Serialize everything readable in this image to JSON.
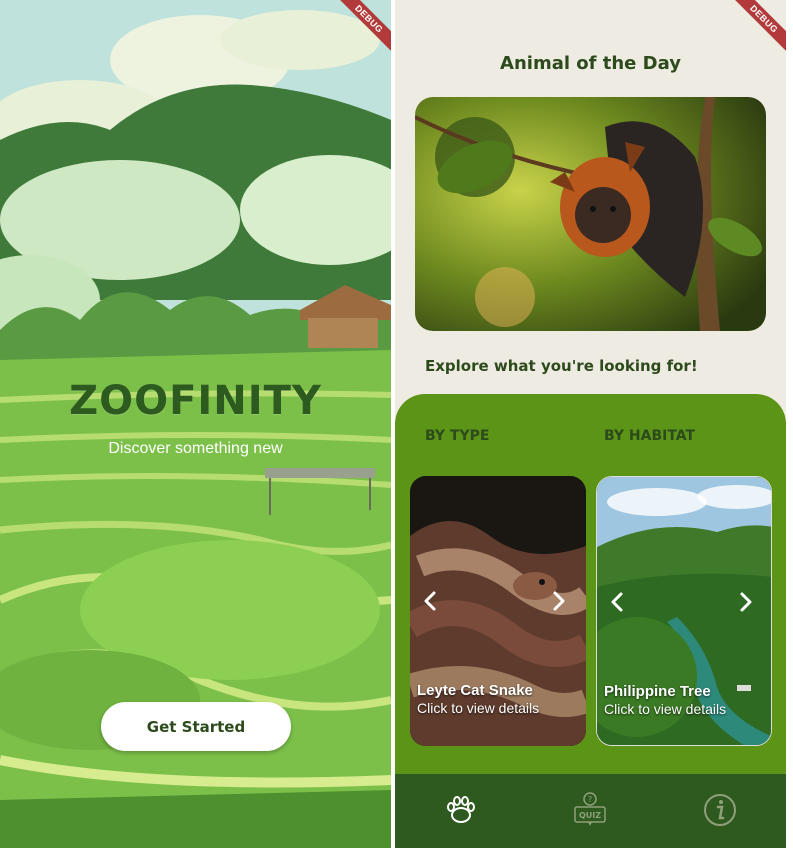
{
  "left_screen": {
    "app_title": "ZOOFINITY",
    "subtitle": "Discover something new",
    "get_started_label": "Get Started",
    "debug_label": "DEBUG"
  },
  "right_screen": {
    "debug_label": "DEBUG",
    "animal_of_the_day_title": "Animal of the Day",
    "explore_title": "Explore what you're looking for!",
    "tabs": [
      {
        "label": "BY TYPE"
      },
      {
        "label": "BY HABITAT"
      }
    ],
    "cards": [
      {
        "name": "Leyte Cat Snake",
        "hint": "Click to view details",
        "image": "snake-photo"
      },
      {
        "name": "Philippine Tree",
        "hint": "Click to view details",
        "image": "forest-river-photo"
      }
    ],
    "bottom_nav": [
      {
        "icon": "paw-icon"
      },
      {
        "icon": "quiz-icon",
        "label": "QUIZ"
      },
      {
        "icon": "info-icon"
      }
    ]
  },
  "colors": {
    "primary_green": "#5c9417",
    "dark_green": "#2f5a1f",
    "title_green": "#2d4a1c",
    "cream": "#eeebe2"
  }
}
